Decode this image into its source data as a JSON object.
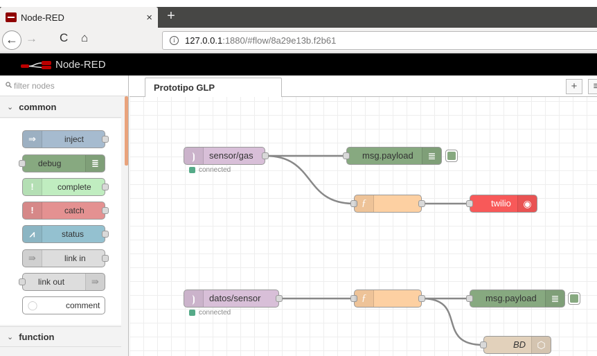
{
  "browser": {
    "tab_title": "Node-RED",
    "tab_close": "×",
    "new_tab": "+",
    "url_host": "127.0.0.1",
    "url_rest": ":1880/#flow/8a29e13b.f2b61",
    "icons": {
      "back": "←",
      "forward": "→",
      "reload": "C",
      "home": "⌂",
      "info": "i"
    }
  },
  "header": {
    "title": "Node-RED"
  },
  "palette": {
    "search_placeholder": "filter nodes",
    "categories": [
      {
        "label": "common",
        "chevron": "⌄"
      },
      {
        "label": "function",
        "chevron": "⌄"
      }
    ],
    "nodes": [
      {
        "label": "inject",
        "color": "#a6bbcf",
        "icon": "⇒"
      },
      {
        "label": "debug",
        "color": "#87a980",
        "icon": "≣"
      },
      {
        "label": "complete",
        "color": "#c0edc0",
        "icon": "!"
      },
      {
        "label": "catch",
        "color": "#e49191",
        "icon": "!"
      },
      {
        "label": "status",
        "color": "#94c1d0",
        "icon": "⩘"
      },
      {
        "label": "link in",
        "color": "#dddddd",
        "icon": "⇛"
      },
      {
        "label": "link out",
        "color": "#dddddd",
        "icon": "⇛"
      },
      {
        "label": "comment",
        "color": "#ffffff",
        "icon": "◯"
      }
    ]
  },
  "workspace": {
    "tab_label": "Prototipo GLP",
    "add_button": "+",
    "menu_button": "≡"
  },
  "flow": {
    "nodes": [
      {
        "label": "sensor/gas",
        "type": "mqtt-in",
        "color": "#d8bfd8",
        "icon": "⦘",
        "status": "connected"
      },
      {
        "label": "msg.payload",
        "type": "debug",
        "color": "#87a980",
        "icon": "≣"
      },
      {
        "label": "",
        "type": "function",
        "color": "#fdd0a2",
        "icon": "ƒ"
      },
      {
        "label": "twilio",
        "type": "twilio",
        "color": "#f85959",
        "icon": "◉"
      },
      {
        "label": "datos/sensor",
        "type": "mqtt-in",
        "color": "#d8bfd8",
        "icon": "⦘",
        "status": "connected"
      },
      {
        "label": "",
        "type": "function",
        "color": "#fdd0a2",
        "icon": "ƒ"
      },
      {
        "label": "msg.payload",
        "type": "debug",
        "color": "#87a980",
        "icon": "≣"
      },
      {
        "label": "BD",
        "type": "database",
        "color": "#e2d1bb",
        "icon": "⬡"
      }
    ]
  }
}
